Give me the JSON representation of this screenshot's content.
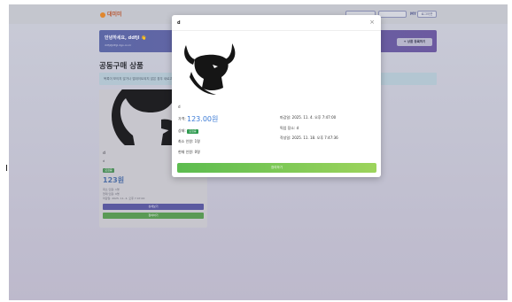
{
  "header": {
    "logo_text": "대미미",
    "nav": [
      "",
      "",
      "",
      "",
      "로그아웃"
    ],
    "nav_link": "MY"
  },
  "welcome": {
    "title": "안녕하세요, ddfjl",
    "emoji": "👋",
    "email": "ddfjl@dfgl.dgo.co.kr",
    "register_button": "+ 상품 등록하기"
  },
  "section": {
    "title": "공동구매 상품",
    "info_text": "목록이 보이지 않거나 업데이트되지 않은 경우 새로고침해주세요"
  },
  "card": {
    "title": "d",
    "description": "d",
    "status": "모집중",
    "price": "123원",
    "min_people": "최소 인원: 1명",
    "current_people": "현재 인원: 0명",
    "deadline": "마감일: 2025. 11. 4. 오후 7:47:00",
    "detail_button": "상세보기",
    "join_button": "참여하기"
  },
  "modal": {
    "title": "d",
    "close": "×",
    "description": "d",
    "price_label": "가격:",
    "price_value": "123.00원",
    "status_label": "상태:",
    "status_value": "모집중",
    "min_people": "최소 인원: 1명",
    "current_people": "현재 인원: 0명",
    "deadline": "마감일: 2025. 11. 4. 오후 7:47:00",
    "location": "픽업 장소: d",
    "created": "작성일: 2025. 11. 18. 오후 7:47:36",
    "join_button": "참여하기"
  },
  "colors": {
    "brand": "#e0872f",
    "price": "#3b7bd6",
    "status": "#2e9a4f",
    "join": "#5cbc4f",
    "welcome_bg": "#5d68a6"
  }
}
